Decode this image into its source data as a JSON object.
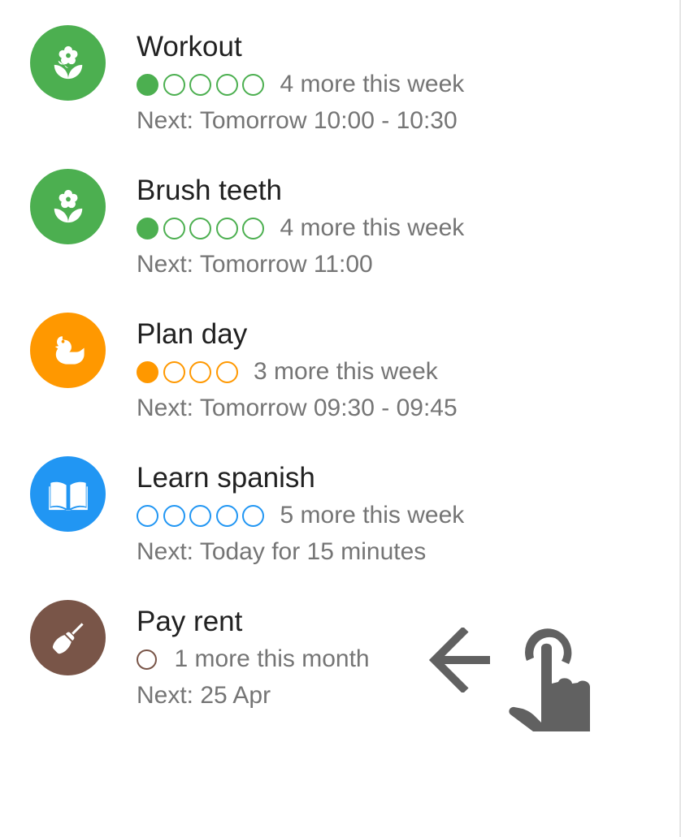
{
  "colors": {
    "green": "#4caf50",
    "orange": "#ff9800",
    "blue": "#2196f3",
    "brown": "#795548",
    "gesture": "#616161"
  },
  "habits": [
    {
      "title": "Workout",
      "icon": "flower-icon",
      "color": "#4caf50",
      "completed": 1,
      "total": 5,
      "progress_text": "4 more this week",
      "next": "Next: Tomorrow 10:00 - 10:30"
    },
    {
      "title": "Brush teeth",
      "icon": "flower-icon",
      "color": "#4caf50",
      "completed": 1,
      "total": 5,
      "progress_text": "4 more this week",
      "next": "Next: Tomorrow 11:00"
    },
    {
      "title": "Plan day",
      "icon": "duck-icon",
      "color": "#ff9800",
      "completed": 1,
      "total": 4,
      "progress_text": "3 more this week",
      "next": "Next: Tomorrow 09:30 - 09:45"
    },
    {
      "title": "Learn spanish",
      "icon": "book-icon",
      "color": "#2196f3",
      "completed": 0,
      "total": 5,
      "progress_text": "5 more this week",
      "next": "Next: Today for 15 minutes"
    },
    {
      "title": "Pay rent",
      "icon": "broom-icon",
      "color": "#795548",
      "completed": 0,
      "total": 1,
      "progress_text": "1 more this month",
      "next": "Next: 25 Apr"
    }
  ],
  "gesture_hint": {
    "arrow_icon": "arrow-left-icon",
    "hand_icon": "touch-hand-icon"
  }
}
